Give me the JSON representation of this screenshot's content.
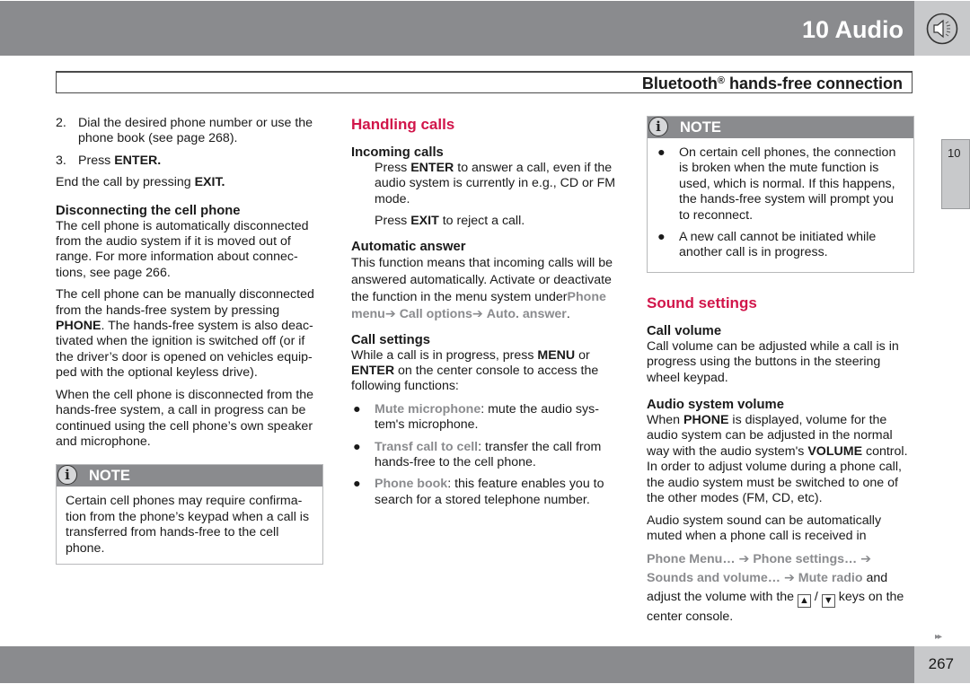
{
  "header": {
    "chapter": "10 Audio",
    "chapter_icon": "speaker-icon",
    "section_title": "Bluetooth",
    "section_title_sup": "®",
    "section_title_rest": " hands-free connection"
  },
  "col1": {
    "steps": [
      {
        "num": "2.",
        "text": "Dial the desired phone number or use the phone book (see page 268)."
      },
      {
        "num": "3.",
        "text_pre": "Press ",
        "bold": "ENTER."
      }
    ],
    "end_call": {
      "pre": "End the call by pressing ",
      "bold": "EXIT."
    },
    "disconnect_heading": "Disconnecting the cell phone",
    "disconnect_p1": "The cell phone is automatically disconnected from the audio system if it is moved out of range. For more information about connec-tions, see page 266.",
    "disconnect_p2_pre": "The cell phone can be manually disconnected from the hands-free system by pressing ",
    "disconnect_p2_bold": "PHONE",
    "disconnect_p2_post": ". The hands-free system is also deac-tivated when the ignition is switched off (or if the driver’s door is opened on vehicles equip-ped with the optional keyless drive).",
    "disconnect_p3": "When the cell phone is disconnected from the hands-free system, a call in progress can be continued using the cell phone’s own speaker and microphone.",
    "note": {
      "label": "NOTE",
      "icon": "info-icon",
      "text": "Certain cell phones may require confirma-tion from the phone’s keypad when a call is transferred from hands-free to the cell phone."
    }
  },
  "col2": {
    "heading": "Handling calls",
    "incoming_heading": "Incoming calls",
    "incoming_p1_pre": "Press ",
    "incoming_p1_bold": "ENTER",
    "incoming_p1_post": " to answer a call, even if the audio system is currently in e.g., CD or FM mode.",
    "incoming_p2_pre": "Press ",
    "incoming_p2_bold": "EXIT",
    "incoming_p2_post": " to reject a call.",
    "auto_heading": "Automatic answer",
    "auto_text": "This function means that incoming calls will be answered automatically. Activate or deactivate the function in the menu system under",
    "auto_menu": [
      "Phone menu",
      "Call options",
      "Auto. answer"
    ],
    "arrow": "➔",
    "settings_heading": "Call settings",
    "settings_pre": "While a call is in progress, press ",
    "settings_bold1": "MENU",
    "settings_mid": " or ",
    "settings_bold2": "ENTER",
    "settings_post": " on the center console to access the following functions:",
    "bullets": [
      {
        "menu": "Mute microphone",
        "text": ": mute the audio sys-tem's microphone."
      },
      {
        "menu": "Transf call to cell",
        "text": ": transfer the call from hands-free to the cell phone."
      },
      {
        "menu": "Phone book",
        "text": ": this feature enables you to search for a stored telephone number."
      }
    ]
  },
  "col3": {
    "note": {
      "label": "NOTE",
      "icon": "info-icon",
      "bullets": [
        "On certain cell phones, the connection is broken when the mute function is used, which is normal. If this happens, the hands-free system will prompt you to reconnect.",
        "A new call cannot be initiated while another call is in progress."
      ]
    },
    "heading": "Sound settings",
    "call_volume_heading": "Call volume",
    "call_volume_text": "Call volume can be adjusted while a call is in progress using the buttons in the steering wheel keypad.",
    "audio_volume_heading": "Audio system volume",
    "audio_volume_pre": "When ",
    "audio_volume_bold1": "PHONE",
    "audio_volume_mid": " is displayed, volume for the audio system can be adjusted in the normal way with the audio system's ",
    "audio_volume_bold2": "VOLUME",
    "audio_volume_post": " control. In order to adjust volume during a phone call, the audio system must be switched to one of the other modes (FM, CD, etc).",
    "mute_text": "Audio system sound can be automatically muted when a phone call is received in",
    "mute_menu": [
      "Phone Menu…",
      "Phone settings…",
      "Sounds and volume…",
      "Mute radio"
    ],
    "mute_and": " and",
    "adjust_pre": "adjust the volume with the ",
    "key_up": "▲",
    "key_sep": " / ",
    "key_down": "▼",
    "adjust_post": " keys on the center console."
  },
  "side_tab": {
    "label": "10"
  },
  "footer": {
    "page_number": "267",
    "continue_icon": "▸▸"
  }
}
